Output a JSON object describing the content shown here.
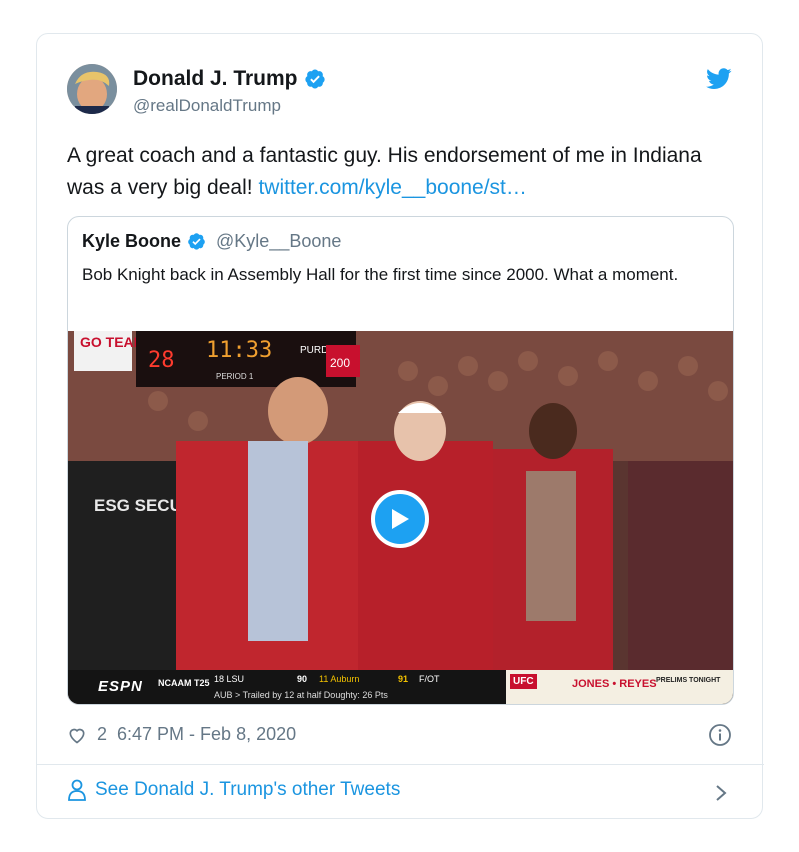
{
  "tweet": {
    "author_name": "Donald J. Trump",
    "author_handle": "@realDonaldTrump",
    "text_main": "A great coach and a fantastic guy. His endorsement of me in Indiana was a very big deal! ",
    "link_text": "twitter.com/kyle__boone/st…",
    "likes": "2",
    "timestamp": "6:47 PM - Feb 8, 2020",
    "see_more": "See Donald J. Trump's other Tweets"
  },
  "quote": {
    "author_name": "Kyle Boone",
    "author_handle": "@Kyle__Boone",
    "text": "Bob Knight back in Assembly Hall for the first time since 2000. What a moment."
  },
  "media": {
    "scoreboard": {
      "logo": "ESPN",
      "league": "NCAAM T25",
      "team1": "18 LSU",
      "score1": "90",
      "team2": "11 Auburn",
      "score2": "91",
      "final": "F/OT",
      "line2": "AUB > Trailed by 12 at half   Doughty: 26 Pts",
      "ad_brand": "UFC",
      "ad_match": "JONES • REYES",
      "ad_prelims": "PRELIMS TONIGHT"
    },
    "arena_text": {
      "go_team": "GO TEAM!",
      "clock": "11:33",
      "home_score": "28",
      "period": "PERIOD 1",
      "purdue": "PURDUE",
      "shot": "200",
      "security": "ESG SECURITY"
    }
  },
  "colors": {
    "accent": "#1da1f2",
    "link": "#1b95e0",
    "secondary_text": "#657786",
    "border": "#e1e8ed"
  },
  "icons": [
    "verified-badge-icon",
    "twitter-bird-icon",
    "play-icon",
    "heart-icon",
    "info-icon",
    "person-icon",
    "chevron-right-icon"
  ]
}
